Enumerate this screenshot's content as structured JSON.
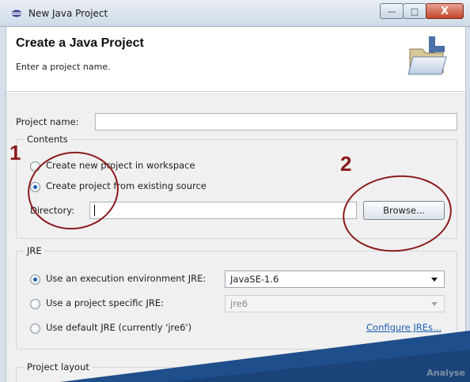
{
  "window": {
    "title": "New Java Project",
    "minimize_glyph": "—",
    "maximize_glyph": "□",
    "close_glyph": "X"
  },
  "header": {
    "title": "Create a Java Project",
    "description": "Enter a project name."
  },
  "project_name": {
    "label": "Project name:",
    "value": ""
  },
  "contents": {
    "title": "Contents",
    "radio_new": {
      "label": "Create new project in workspace",
      "checked": false
    },
    "radio_existing": {
      "label": "Create project from existing source",
      "checked": true
    },
    "directory_label": "Directory:",
    "directory_value": "",
    "browse_label": "Browse..."
  },
  "jre": {
    "title": "JRE",
    "radio_env": {
      "label": "Use an execution environment JRE:",
      "checked": true,
      "value": "JavaSE-1.6"
    },
    "radio_specific": {
      "label": "Use a project specific JRE:",
      "checked": false,
      "value": "jre6"
    },
    "radio_default": {
      "label": "Use default JRE (currently 'jre6')",
      "checked": false
    },
    "configure_link": "Configure JREs..."
  },
  "project_layout": {
    "title": "Project layout"
  },
  "annotations": {
    "one": "1",
    "two": "2"
  },
  "watermark": "Analyse",
  "icons": {
    "window": "eclipse-icon",
    "header": "java-folder-icon"
  },
  "colors": {
    "annotation": "#8b1a1a",
    "link": "#1a5fb4",
    "radio_dot": "#1f5fb6",
    "close_button": "#c2452b"
  }
}
